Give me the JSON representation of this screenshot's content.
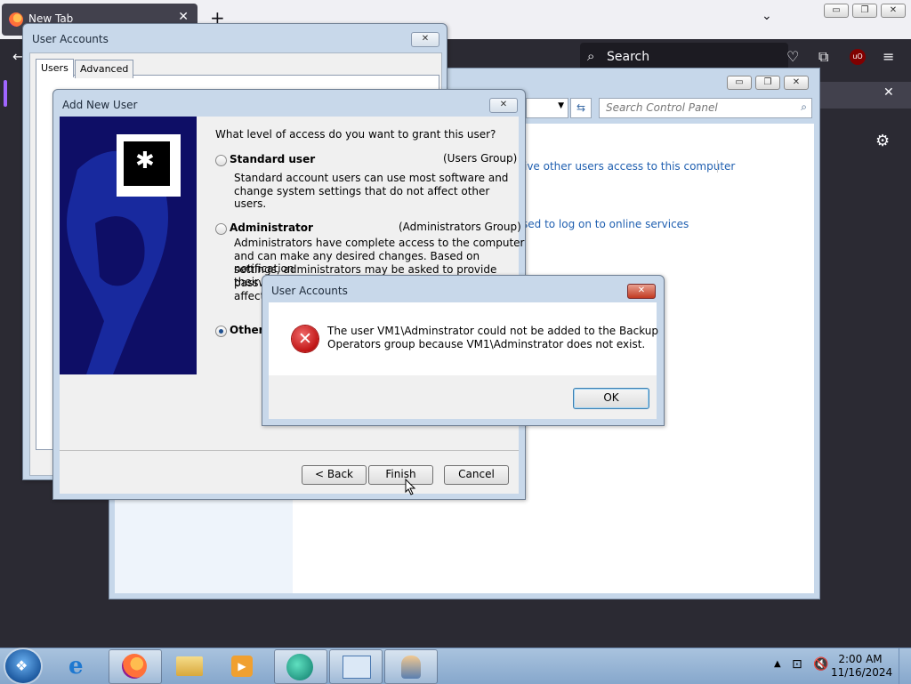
{
  "firefox": {
    "tab_title": "New Tab",
    "search_placeholder": "Search"
  },
  "control_panel": {
    "search_placeholder": "Search Control Panel",
    "link1": "ive other users access to this computer",
    "link2": "sed to log on to online services"
  },
  "user_accounts": {
    "title": "User Accounts",
    "tabs": [
      "Users",
      "Advanced"
    ]
  },
  "add_new_user": {
    "title": "Add New User",
    "question": "What level of access do you want to grant this user?",
    "standard": {
      "label": "Standard user",
      "group": "(Users Group)",
      "desc1": "Standard account users can use most software and",
      "desc2": "change system settings that do not affect other users."
    },
    "admin": {
      "label": "Administrator",
      "group": "(Administrators Group)",
      "desc1": "Administrators have complete access to the computer",
      "desc2": "and can make any desired changes. Based on notification",
      "desc3": "settings, administrators may be asked to provide their",
      "desc4": "passw",
      "desc5": "affect"
    },
    "other_label": "Other:",
    "buttons": {
      "back": "< Back",
      "finish": "Finish",
      "cancel": "Cancel"
    }
  },
  "error_dialog": {
    "title": "User Accounts",
    "line1": "The user VM1\\Adminstrator could not be added to the Backup",
    "line2": "Operators group because VM1\\Adminstrator does not exist.",
    "ok": "OK"
  },
  "taskbar": {
    "time": "2:00 AM",
    "date": "11/16/2024"
  }
}
